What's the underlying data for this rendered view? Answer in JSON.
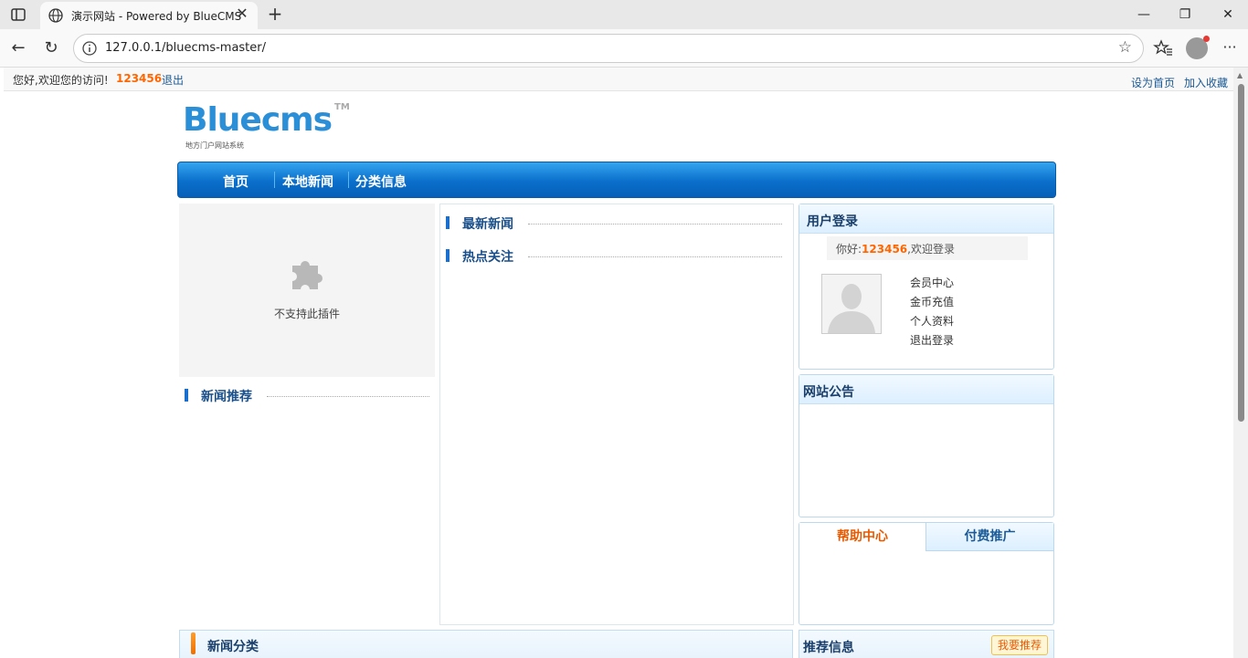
{
  "browser": {
    "tab_title": "演示网站 - Powered by BlueCMS",
    "url": "127.0.0.1/bluecms-master/"
  },
  "topbar": {
    "greeting": "您好,欢迎您的访问!",
    "username": "123456",
    "logout": "退出",
    "set_home": "设为首页",
    "add_favorite": "加入收藏"
  },
  "logo": {
    "wordmark": "Bluecms",
    "tm": "TM",
    "slogan": "地方门户网站系统"
  },
  "nav": {
    "items": [
      "首页",
      "本地新闻",
      "分类信息"
    ]
  },
  "plugin": {
    "message": "不支持此插件"
  },
  "sections": {
    "recommended_news": "新闻推荐",
    "latest_news": "最新新闻",
    "hot_focus": "热点关注",
    "news_category": "新闻分类"
  },
  "login": {
    "title": "用户登录",
    "hello_prefix": "你好:",
    "hello_name": "123456",
    "hello_suffix": ",欢迎登录",
    "links": [
      "会员中心",
      "金币充值",
      "个人资料",
      "退出登录"
    ]
  },
  "notice": {
    "title": "网站公告"
  },
  "help_tabs": {
    "tab1": "帮助中心",
    "tab2": "付费推广"
  },
  "recommend": {
    "title": "推荐信息",
    "button": "我要推荐"
  }
}
